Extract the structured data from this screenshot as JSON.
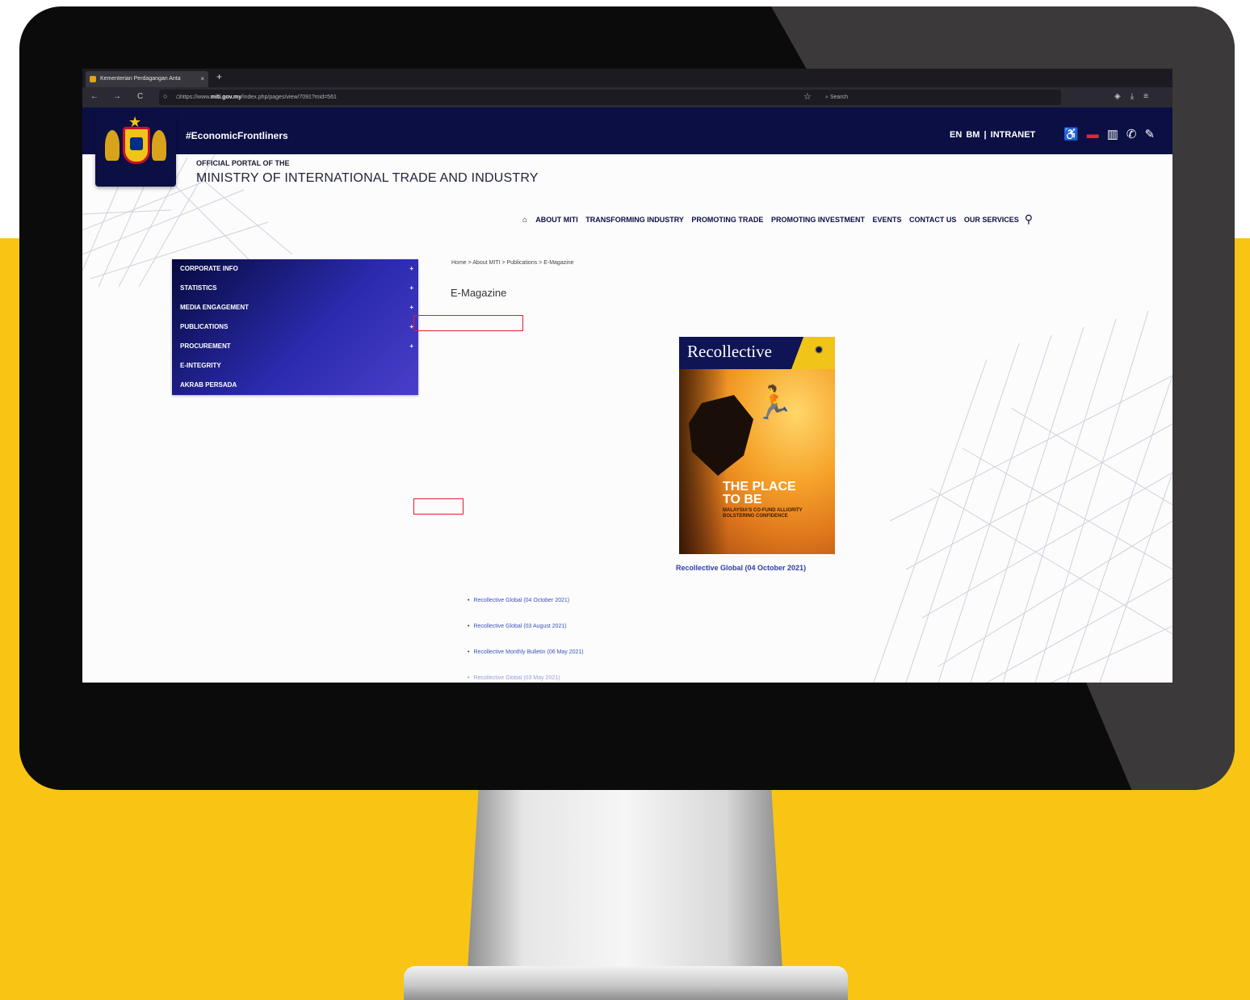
{
  "browser": {
    "tab_title": "Kementerian Perdagangan Anta",
    "tab_close": "×",
    "new_tab": "+",
    "url_prefix": "https://www.",
    "url_domain": "miti.gov.my",
    "url_suffix": "/index.php/pages/view/7091?mid=561",
    "search_placeholder": "Search",
    "nav_back": "←",
    "nav_forward": "→",
    "nav_reload": "C"
  },
  "header": {
    "hashtag": "#EconomicFrontliners",
    "lang_en": "EN",
    "lang_bm": "BM",
    "separator": "|",
    "intranet": "INTRANET",
    "portal_title": "OFFICIAL PORTAL OF THE",
    "ministry": "MINISTRY OF INTERNATIONAL TRADE AND INDUSTRY"
  },
  "nav": {
    "items": [
      "ABOUT MITI",
      "TRANSFORMING INDUSTRY",
      "PROMOTING TRADE",
      "PROMOTING INVESTMENT",
      "EVENTS",
      "CONTACT US",
      "OUR SERVICES"
    ]
  },
  "sidebar": {
    "items": [
      {
        "label": "CORPORATE INFO",
        "plus": "+"
      },
      {
        "label": "STATISTICS",
        "plus": "+"
      },
      {
        "label": "MEDIA ENGAGEMENT",
        "plus": "+"
      },
      {
        "label": "PUBLICATIONS",
        "plus": "+"
      },
      {
        "label": "PROCUREMENT",
        "plus": "+"
      },
      {
        "label": "E-INTEGRITY",
        "plus": ""
      },
      {
        "label": "AKRAB PERSADA",
        "plus": ""
      }
    ]
  },
  "content": {
    "breadcrumb": "Home  > About MITI  > Publications  > E-Magazine",
    "page_title": "E-Magazine",
    "cover": {
      "title": "Recollective",
      "headline_1": "THE PLACE",
      "headline_2": "TO BE",
      "subheadline": "MALAYSIA'S CO-FUND ALLIGRITY BOLSTERING CONFIDENCE"
    },
    "featured_caption": "Recollective Global (04 October 2021)",
    "list": [
      "Recollective Global (04 October 2021)",
      "Recollective Global (03 August 2021)",
      "Recollective Monthly Bulletin (06 May 2021)",
      "Recollective Global (03 May 2021)"
    ]
  },
  "colors": {
    "header_navy": "#0b0f44",
    "accent_yellow": "#f8c515",
    "link_blue": "#2a3fa8",
    "highlight_red": "#e0202a"
  }
}
